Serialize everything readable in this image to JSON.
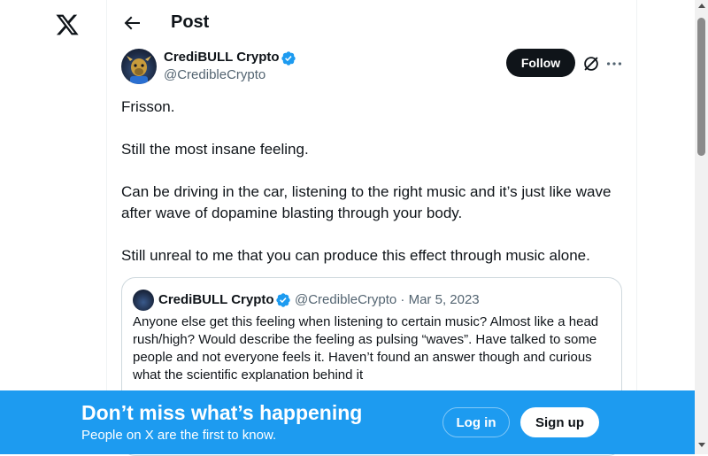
{
  "header": {
    "title": "Post"
  },
  "post": {
    "author_name": "CrediBULL Crypto",
    "author_handle": "@CredibleCrypto",
    "follow_label": "Follow",
    "paragraphs": [
      "Frisson.",
      "Still the most insane feeling.",
      "Can be driving in the car, listening to the right music and it’s just like wave after wave of dopamine blasting through your body.",
      "Still unreal to me that you can produce this effect through music alone."
    ]
  },
  "quote": {
    "author_name": "CrediBULL Crypto",
    "meta": "@CredibleCrypto · Mar 5, 2023",
    "text": "Anyone else get this feeling when listening to certain music? Almost like a head rush/high? Would describe the feeling as pulsing “waves”. Have talked to some people and not everyone feels it. Haven’t found an answer though and curious what the scientific explanation behind it"
  },
  "banner": {
    "title": "Don’t miss what’s happening",
    "subtitle": "People on X are the first to know.",
    "login_label": "Log in",
    "signup_label": "Sign up"
  },
  "colors": {
    "accent": "#1d9bf0",
    "text": "#0f1419",
    "muted": "#536471",
    "border": "#cfd9de"
  },
  "icons": [
    "x-logo-icon",
    "back-arrow-icon",
    "verified-badge-icon",
    "grok-icon",
    "more-icon"
  ]
}
